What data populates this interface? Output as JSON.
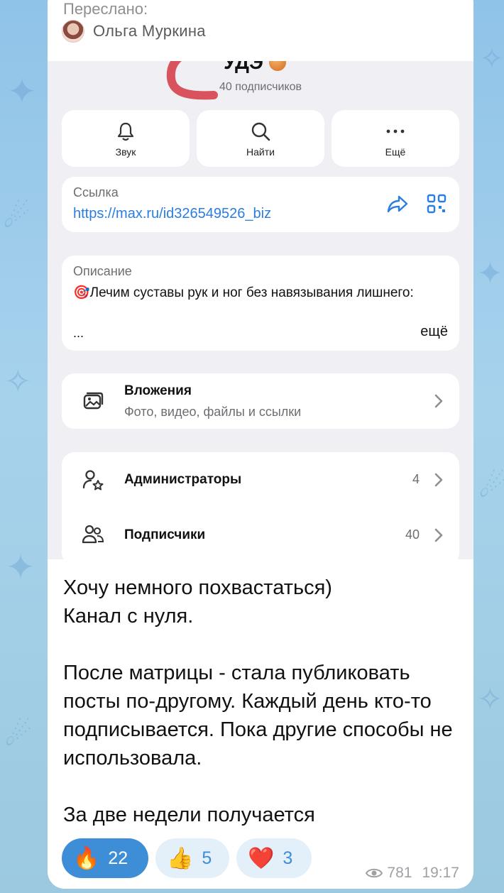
{
  "forward": {
    "label": "Переслано:",
    "author": "Ольга Муркина"
  },
  "profile": {
    "title": "УДЭ",
    "subscribers": "40 подписчиков",
    "actions": [
      {
        "label": "Звук",
        "icon": "bell-icon"
      },
      {
        "label": "Найти",
        "icon": "search-icon"
      },
      {
        "label": "Ещё",
        "icon": "more-icon"
      }
    ],
    "link": {
      "caption": "Ссылка",
      "url": "https://max.ru/id326549526_biz"
    },
    "description": {
      "caption": "Описание",
      "text": "🎯Лечим суставы рук и ног без навязывания лишнего:",
      "dots": "...",
      "more": "ещё"
    },
    "attachments": {
      "title": "Вложения",
      "subtitle": "Фото, видео, файлы и ссылки"
    },
    "admins": {
      "title": "Администраторы",
      "count": "4"
    },
    "members": {
      "title": "Подписчики",
      "count": "40"
    }
  },
  "message": {
    "text": "Хочу немного похвастаться)\nКанал с нуля.\n\nПосле матрицы - стала публиковать посты по-другому. Каждый день кто-то подписывается.  Пока другие способы не использовала.\n\nЗа две недели получается"
  },
  "reactions": [
    {
      "emoji": "🔥",
      "count": "22",
      "active": true
    },
    {
      "emoji": "👍",
      "count": "5",
      "active": false
    },
    {
      "emoji": "❤️",
      "count": "3",
      "active": false
    }
  ],
  "meta": {
    "views": "781",
    "time": "19:17"
  },
  "colors": {
    "accent": "#3e8ed7",
    "link": "#2a7de1",
    "background": "#9cc9e6"
  }
}
